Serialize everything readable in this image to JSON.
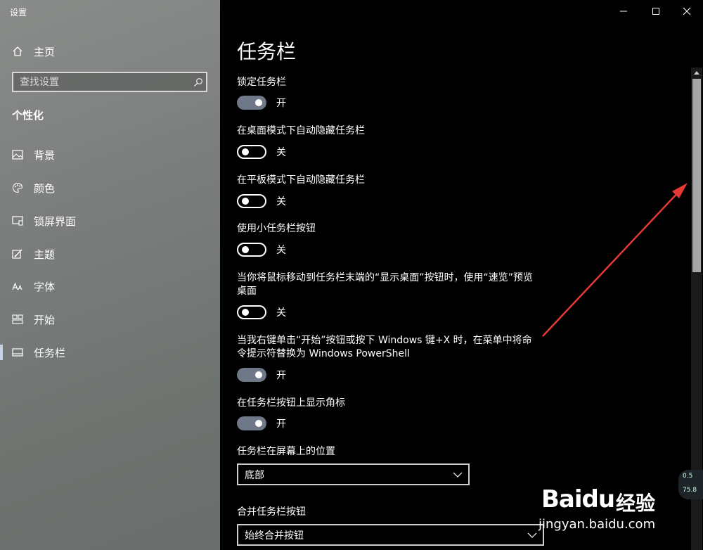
{
  "window": {
    "title": "设置",
    "controls": {
      "minimize": "minimize-icon",
      "maximize": "maximize-icon",
      "close": "close-icon"
    }
  },
  "sidebar": {
    "home_label": "主页",
    "search_placeholder": "查找设置",
    "section_title": "个性化",
    "items": [
      {
        "label": "背景",
        "icon": "picture-icon"
      },
      {
        "label": "颜色",
        "icon": "palette-icon"
      },
      {
        "label": "锁屏界面",
        "icon": "lock-screen-icon"
      },
      {
        "label": "主题",
        "icon": "theme-brush-icon"
      },
      {
        "label": "字体",
        "icon": "font-icon"
      },
      {
        "label": "开始",
        "icon": "start-grid-icon"
      },
      {
        "label": "任务栏",
        "icon": "taskbar-icon",
        "selected": true
      }
    ]
  },
  "main": {
    "page_title": "任务栏",
    "settings": [
      {
        "label": "锁定任务栏",
        "state": "开",
        "on": true
      },
      {
        "label": "在桌面模式下自动隐藏任务栏",
        "state": "关",
        "on": false
      },
      {
        "label": "在平板模式下自动隐藏任务栏",
        "state": "关",
        "on": false
      },
      {
        "label": "使用小任务栏按钮",
        "state": "关",
        "on": false
      },
      {
        "label": "当你将鼠标移动到任务栏末端的“显示桌面”按钮时，使用“速览”预览桌面",
        "state": "关",
        "on": false
      },
      {
        "label": "当我右键单击“开始”按钮或按下 Windows 键+X 时，在菜单中将命令提示符替换为 Windows PowerShell",
        "state": "开",
        "on": true
      },
      {
        "label": "在任务栏按钮上显示角标",
        "state": "开",
        "on": true
      }
    ],
    "position": {
      "label": "任务栏在屏幕上的位置",
      "value": "底部"
    },
    "combine": {
      "label": "合并任务栏按钮",
      "value": "始终合并按钮"
    }
  },
  "overlay": {
    "net_up": "0.5",
    "net_down": "75.8",
    "watermark_logo": "Baidu",
    "watermark_cn": "经验",
    "watermark_url": "jingyan.baidu.com",
    "arrow_color": "#e53935"
  },
  "colors": {
    "toggle_on": "#6e7888",
    "selection_bar": "#c8d2e6"
  }
}
